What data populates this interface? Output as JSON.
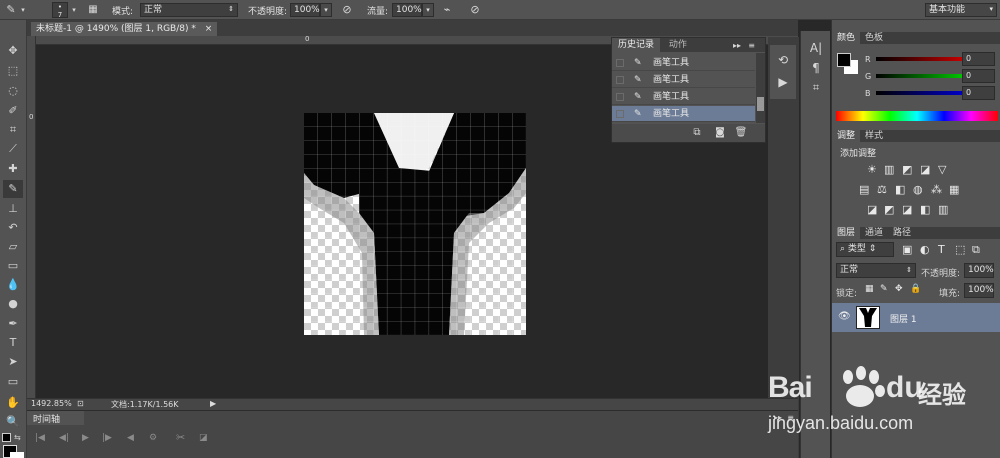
{
  "options_bar": {
    "brush_size": "7",
    "mode_label": "模式:",
    "mode_value": "正常",
    "opacity_label": "不透明度:",
    "opacity_value": "100%",
    "flow_label": "流量:",
    "flow_value": "100%",
    "workspace_value": "基本功能"
  },
  "document": {
    "tab_title": "未标题-1 @ 1490% (图层 1, RGB/8) *",
    "close_glyph": "×",
    "ruler_zero": "0",
    "ruler_v_zero": "0"
  },
  "status": {
    "zoom": "1492.85%",
    "doc_info": "文档:1.17K/1.56K"
  },
  "timeline": {
    "tab_label": "时间轴"
  },
  "history_panel": {
    "tab_active": "历史记录",
    "tab_inactive": "动作",
    "items": [
      {
        "label": "画笔工具"
      },
      {
        "label": "画笔工具"
      },
      {
        "label": "画笔工具"
      },
      {
        "label": "画笔工具",
        "selected": true
      }
    ]
  },
  "color_panel": {
    "tab_active": "颜色",
    "tab_inactive": "色板",
    "r_label": "R",
    "g_label": "G",
    "b_label": "B",
    "r_value": "0",
    "g_value": "0",
    "b_value": "0"
  },
  "adjustments_panel": {
    "tab_active": "调整",
    "tab_inactive": "样式",
    "title": "添加调整"
  },
  "layers_panel": {
    "tab_layers": "图层",
    "tab_channels": "通道",
    "tab_paths": "路径",
    "kind_filter": "类型",
    "blend_mode": "正常",
    "opacity_label": "不透明度:",
    "opacity_value": "100%",
    "lock_label": "锁定:",
    "fill_label": "填充:",
    "fill_value": "100%",
    "layer_name": "图层 1"
  },
  "watermark": {
    "brand": "Bai",
    "brand2": "du",
    "cn": "经验",
    "url": "jingyan.baidu.com"
  },
  "colors": {
    "accent_selection": "#6c7c96",
    "panel_bg": "#535353",
    "canvas_bg": "#282828"
  }
}
